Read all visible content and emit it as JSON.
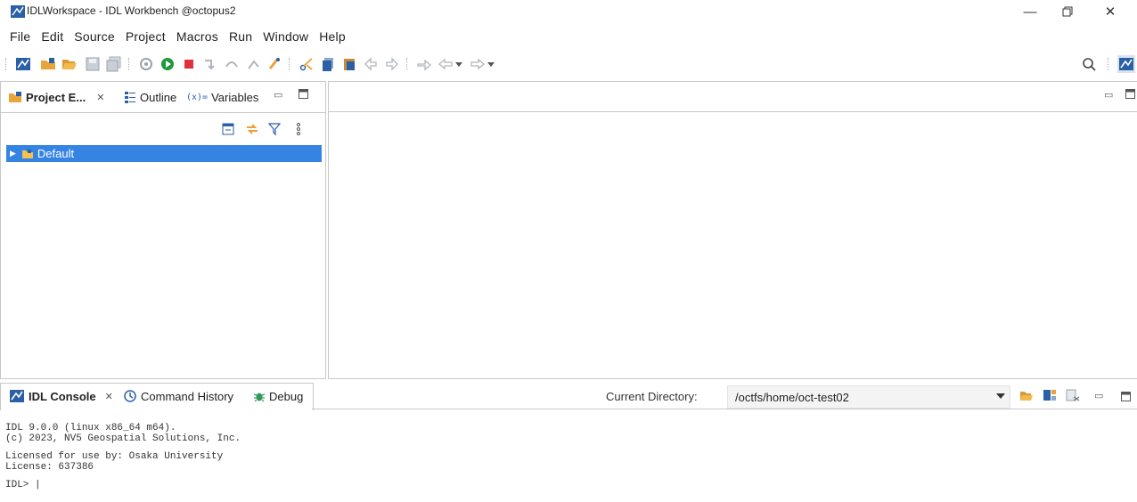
{
  "window": {
    "title": "IDLWorkspace - IDL Workbench @octopus2",
    "controls": [
      "minimize",
      "maximize",
      "close"
    ]
  },
  "menubar": {
    "items": [
      "File",
      "Edit",
      "Source",
      "Project",
      "Macros",
      "Run",
      "Window",
      "Help"
    ]
  },
  "toolbar": {
    "icons": [
      "idl-icon",
      "new-folder-icon",
      "open-folder-icon",
      "save-icon",
      "save-all-icon",
      "compile-icon",
      "run-icon",
      "stop-icon",
      "step-into-icon",
      "step-over-icon",
      "step-return-icon",
      "reset-icon",
      "cut-icon",
      "copy-icon",
      "paste-icon",
      "undo-icon",
      "redo-icon",
      "next-annotation-icon",
      "back-icon",
      "back-dropdown-icon",
      "forward-icon",
      "forward-dropdown-icon",
      "search-icon",
      "perspective-icon"
    ]
  },
  "left_panel": {
    "tabs": [
      {
        "label": "Project E...",
        "icon": "project-explorer-icon",
        "active": true
      },
      {
        "label": "Outline",
        "icon": "outline-icon",
        "active": false
      },
      {
        "label": "Variables",
        "icon": "variables-icon",
        "active": false
      }
    ],
    "close_glyph": "✕",
    "tree": [
      {
        "label": "Default",
        "selected": true,
        "expanded": false
      }
    ]
  },
  "console": {
    "tabs": [
      {
        "label": "IDL Console",
        "icon": "idl-console-icon",
        "active": true
      },
      {
        "label": "Command History",
        "icon": "history-icon",
        "active": false
      },
      {
        "label": "Debug",
        "icon": "debug-icon",
        "active": false
      }
    ],
    "current_directory_label": "Current Directory:",
    "current_directory_value": "/octfs/home/oct-test02",
    "lines": [
      "IDL 9.0.0 (linux x86_64 m64).",
      "(c) 2023, NV5 Geospatial Solutions, Inc.",
      "",
      "Licensed for use by: Osaka University",
      "License: 637386",
      "",
      "IDL> |"
    ]
  },
  "colors": {
    "selection": "#3584e4",
    "run_green": "#1e9a3a",
    "stop_red": "#e0303a",
    "icon_blue": "#2b5fa6",
    "folder_orange": "#e8a33a"
  }
}
